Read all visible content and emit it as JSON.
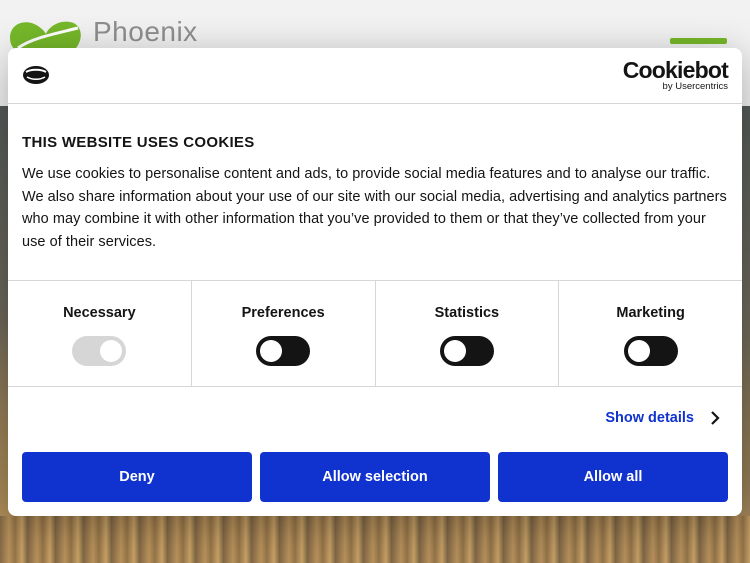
{
  "site": {
    "logo_text": "Phoenix",
    "accent_color": "#76b82a"
  },
  "banner": {
    "brand": {
      "name": "Cookiebot",
      "subtitle": "by Usercentrics",
      "icon": "cookie-icon"
    },
    "title": "THIS WEBSITE USES COOKIES",
    "body": "We use cookies to personalise content and ads, to provide social media features and to analyse our traffic. We also share information about your use of our site with our social media, advertising and analytics partners who may combine it with other information that you’ve provided to them or that they’ve collected from your use of their services.",
    "categories": [
      {
        "label": "Necessary",
        "checked": true,
        "disabled": true
      },
      {
        "label": "Preferences",
        "checked": false,
        "disabled": false
      },
      {
        "label": "Statistics",
        "checked": false,
        "disabled": false
      },
      {
        "label": "Marketing",
        "checked": false,
        "disabled": false
      }
    ],
    "show_details_label": "Show details",
    "buttons": {
      "deny": "Deny",
      "allow_selection": "Allow selection",
      "allow_all": "Allow all"
    },
    "button_color": "#1032cf"
  }
}
